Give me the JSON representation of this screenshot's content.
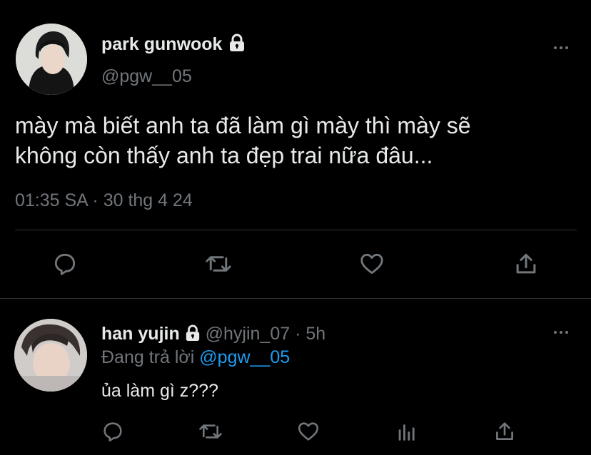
{
  "main_tweet": {
    "display_name": "park gunwook",
    "handle": "@pgw__05",
    "text_line1": "mày mà biết anh ta đã làm gì mày thì mày sẽ",
    "text_line2": "không còn thấy anh ta đẹp trai nữa đâu...",
    "timestamp": "01:35 SA · 30 thg 4 24",
    "actions": [
      "reply-icon",
      "retweet-icon",
      "like-icon",
      "share-icon"
    ]
  },
  "reply": {
    "display_name": "han yujin",
    "handle": "@hyjin_07",
    "time": "· 5h",
    "replying_prefix": "Đang trả lời",
    "replying_to": "@pgw__05",
    "text": "ủa làm gì z???",
    "actions": [
      "reply-icon",
      "retweet-icon",
      "like-icon",
      "analytics-icon",
      "share-icon"
    ]
  },
  "colors": {
    "background": "#000000",
    "text": "#e7e9ea",
    "muted": "#71767b",
    "link": "#1d9bf0",
    "divider": "#2f3336"
  }
}
